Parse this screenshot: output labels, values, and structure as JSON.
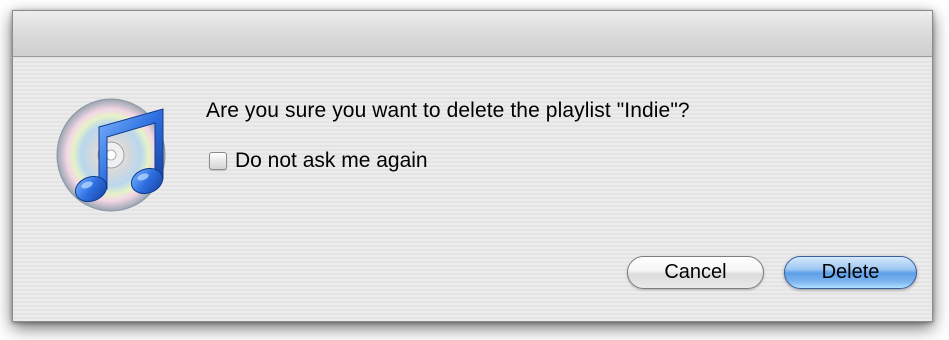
{
  "dialog": {
    "message": "Are you sure you want to delete the playlist \"Indie\"?",
    "checkbox": {
      "label": "Do not ask me again",
      "checked": false
    },
    "buttons": {
      "cancel_label": "Cancel",
      "delete_label": "Delete"
    },
    "icon": "itunes-app-icon"
  },
  "colors": {
    "default_button": "#5d9ee8",
    "dialog_background": "#ececec",
    "titlebar": "#d9d9d9"
  }
}
